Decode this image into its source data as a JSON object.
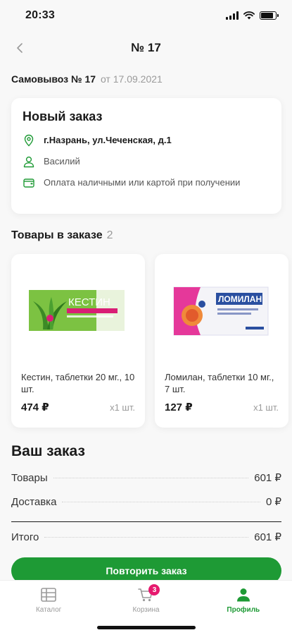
{
  "status_bar": {
    "time": "20:33"
  },
  "nav": {
    "title": "№ 17"
  },
  "pickup": {
    "title": "Самовывоз № 17",
    "date": "от 17.09.2021"
  },
  "order": {
    "status": "Новый заказ",
    "address": "г.Назрань, ул.Чеченская, д.1",
    "customer": "Василий",
    "payment": "Оплата наличными или картой при получении"
  },
  "products_section": {
    "title": "Товары в заказе",
    "count": "2"
  },
  "products": [
    {
      "name": "Кестин, таблетки 20 мг., 10 шт.",
      "price": "474 ₽",
      "qty": "x1 шт.",
      "box_brand": "КЕСТИН"
    },
    {
      "name": "Ломилан, таблетки 10 мг., 7 шт.",
      "price": "127 ₽",
      "qty": "x1 шт.",
      "box_brand": "ЛОМИЛАН"
    }
  ],
  "summary": {
    "title": "Ваш заказ",
    "goods_label": "Товары",
    "goods_value": "601 ₽",
    "delivery_label": "Доставка",
    "delivery_value": "0 ₽",
    "total_label": "Итого",
    "total_value": "601 ₽"
  },
  "actions": {
    "repeat_label": "Повторить заказ"
  },
  "tabs": [
    {
      "label": "Каталог",
      "icon": "catalog-icon"
    },
    {
      "label": "Корзина",
      "icon": "cart-icon",
      "badge": "3"
    },
    {
      "label": "Профиль",
      "icon": "profile-icon",
      "active": true
    }
  ],
  "colors": {
    "accent": "#1e9a35",
    "badge": "#e6196e",
    "muted": "#9a9a9a"
  }
}
